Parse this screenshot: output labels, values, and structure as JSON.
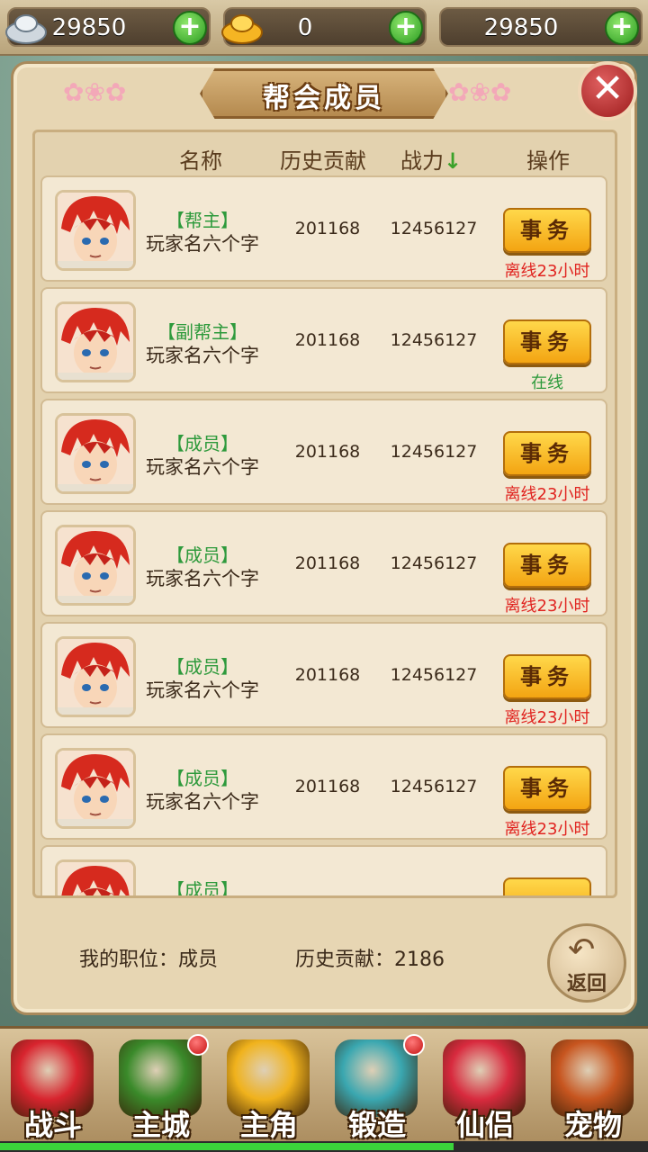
{
  "currency": {
    "silver": {
      "value": "29850",
      "icon": "silver-ingot-icon"
    },
    "gold": {
      "value": "0",
      "icon": "gold-ingot-icon"
    },
    "third": {
      "value": "29850"
    },
    "plus": "+"
  },
  "panel": {
    "title": "帮会成员",
    "close": "✕"
  },
  "headers": {
    "name": "名称",
    "contribution": "历史贡献",
    "power": "战力",
    "power_sort_icon": "↓",
    "action": "操作"
  },
  "members": [
    {
      "rank": "【帮主】",
      "name": "玩家名六个字",
      "contribution": "201168",
      "power": "12456127",
      "button": "事务",
      "status": "离线23小时",
      "status_color": "#e0231f"
    },
    {
      "rank": "【副帮主】",
      "name": "玩家名六个字",
      "contribution": "201168",
      "power": "12456127",
      "button": "事务",
      "status": "在线",
      "status_color": "#2e9a3c"
    },
    {
      "rank": "【成员】",
      "name": "玩家名六个字",
      "contribution": "201168",
      "power": "12456127",
      "button": "事务",
      "status": "离线23小时",
      "status_color": "#e0231f"
    },
    {
      "rank": "【成员】",
      "name": "玩家名六个字",
      "contribution": "201168",
      "power": "12456127",
      "button": "事务",
      "status": "离线23小时",
      "status_color": "#e0231f"
    },
    {
      "rank": "【成员】",
      "name": "玩家名六个字",
      "contribution": "201168",
      "power": "12456127",
      "button": "事务",
      "status": "离线23小时",
      "status_color": "#e0231f"
    },
    {
      "rank": "【成员】",
      "name": "玩家名六个字",
      "contribution": "201168",
      "power": "12456127",
      "button": "事务",
      "status": "离线23小时",
      "status_color": "#e0231f"
    },
    {
      "rank": "【成员】",
      "name": "",
      "contribution": "",
      "power": "",
      "button": "",
      "status": "",
      "status_color": "#e0231f"
    }
  ],
  "footer": {
    "position": "我的职位：成员",
    "contribution": "历史贡献：2186",
    "back": "返回",
    "back_icon": "↶"
  },
  "nav": [
    {
      "label": "战斗",
      "icon": "battle-icon",
      "color": "#d8242e",
      "badge": false
    },
    {
      "label": "主城",
      "icon": "city-icon",
      "color": "#3a8a2a",
      "badge": true
    },
    {
      "label": "主角",
      "icon": "hero-icon",
      "color": "#f0b21c",
      "badge": false
    },
    {
      "label": "锻造",
      "icon": "forge-hammer-icon",
      "color": "#3aa7b0",
      "badge": true
    },
    {
      "label": "仙侣",
      "icon": "heart-icon",
      "color": "#d82a3e",
      "badge": false
    },
    {
      "label": "宠物",
      "icon": "monkey-pet-icon",
      "color": "#c7551f",
      "badge": false
    }
  ],
  "nav_progress": 0.7
}
